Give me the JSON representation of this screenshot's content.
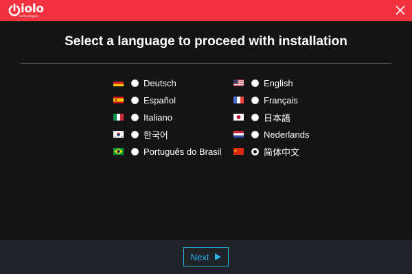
{
  "window": {
    "brand_name": "iolo",
    "brand_sub": "technologies",
    "close_icon": "close-icon"
  },
  "colors": {
    "titlebar": "#f33240",
    "background": "#141414",
    "footer": "#20232a",
    "accent": "#2bb6e8"
  },
  "heading": "Select a language to proceed with installation",
  "languages": {
    "left": [
      {
        "label": "Deutsch",
        "flag": "de-flag-icon",
        "selected": false
      },
      {
        "label": "Español",
        "flag": "es-flag-icon",
        "selected": false
      },
      {
        "label": "Italiano",
        "flag": "it-flag-icon",
        "selected": false
      },
      {
        "label": "한국어",
        "flag": "kr-flag-icon",
        "selected": false
      },
      {
        "label": "Português do Brasil",
        "flag": "br-flag-icon",
        "selected": false
      }
    ],
    "right": [
      {
        "label": "English",
        "flag": "us-flag-icon",
        "selected": false
      },
      {
        "label": "Français",
        "flag": "fr-flag-icon",
        "selected": false
      },
      {
        "label": "日本語",
        "flag": "jp-flag-icon",
        "selected": false
      },
      {
        "label": "Nederlands",
        "flag": "nl-flag-icon",
        "selected": false
      },
      {
        "label": "简体中文",
        "flag": "cn-flag-icon",
        "selected": true
      }
    ]
  },
  "footer": {
    "next_label": "Next",
    "next_icon": "play-arrow-icon"
  }
}
